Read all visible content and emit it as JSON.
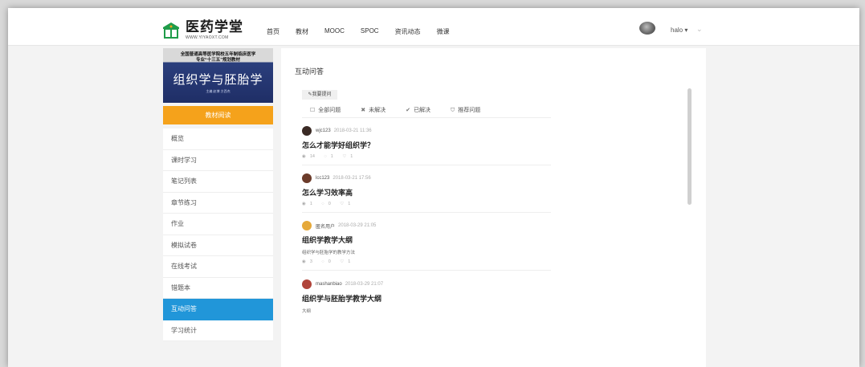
{
  "header": {
    "logo_text": "医药学堂",
    "logo_url": "WWW.YIYAOXT.COM",
    "nav": [
      "首页",
      "教材",
      "MOOC",
      "SPOC",
      "资讯动态",
      "微课"
    ],
    "username": "halo",
    "caret": "⌄"
  },
  "book": {
    "line1": "全国普通高等医学院校五年制临床医学",
    "line2": "专业“十三五”规划教材",
    "title": "组织学与胚胎学",
    "authors": "主编  赵博  方西杰"
  },
  "read_button": "教材阅读",
  "sidebar": {
    "items": [
      "概览",
      "课时学习",
      "笔记列表",
      "章节练习",
      "作业",
      "模拟试卷",
      "在线考试",
      "错题本",
      "互动问答",
      "学习统计"
    ],
    "active_index": 8
  },
  "main": {
    "title": "互动问答",
    "ask_button": "✎我要提问",
    "filters": [
      {
        "icon": "☐",
        "icon_name": "checkbox-icon",
        "label": "全部问题"
      },
      {
        "icon": "✖",
        "icon_name": "x-icon",
        "label": "未解决"
      },
      {
        "icon": "✔",
        "icon_name": "check-icon",
        "label": "已解决"
      },
      {
        "icon": "⛉",
        "icon_name": "shield-icon",
        "label": "推荐问题"
      }
    ],
    "questions": [
      {
        "user": "wjc123",
        "time": "2018-03-21 11:36",
        "title": "怎么才能学好组织学？",
        "body": "",
        "views": "14",
        "comments": "1",
        "likes": "1",
        "avatar_color": "#3a2a24"
      },
      {
        "user": "lcc123",
        "time": "2018-03-21 17:56",
        "title": "怎么学习效率高",
        "body": "",
        "views": "1",
        "comments": "0",
        "likes": "1",
        "avatar_color": "#6b3b2a"
      },
      {
        "user": "匿名用户",
        "time": "2018-03-29 21:05",
        "title": "组织学教学大纲",
        "body": "组织学与胚胎学的教学方法",
        "views": "3",
        "comments": "0",
        "likes": "1",
        "avatar_color": "#e6a93a"
      },
      {
        "user": "mashanbiao",
        "time": "2018-03-29 21:07",
        "title": "组织学与胚胎学教学大纲",
        "body": "大纲",
        "views": "",
        "comments": "",
        "likes": "",
        "avatar_color": "#b0443a"
      }
    ],
    "meta_icons": {
      "views": "◉",
      "comments": "◌",
      "likes": "♡"
    }
  },
  "colors": {
    "accent_blue": "#2196d9",
    "accent_orange": "#f5a21b"
  }
}
